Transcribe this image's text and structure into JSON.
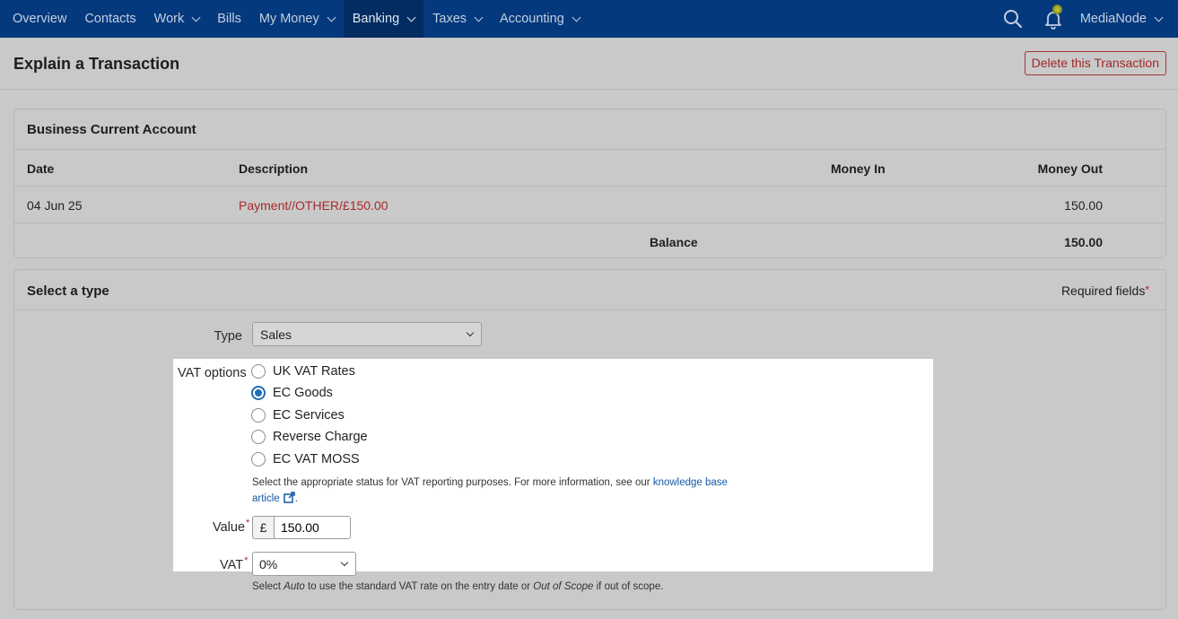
{
  "nav": {
    "items": [
      {
        "label": "Overview",
        "has_menu": false
      },
      {
        "label": "Contacts",
        "has_menu": false
      },
      {
        "label": "Work",
        "has_menu": true
      },
      {
        "label": "Bills",
        "has_menu": false
      },
      {
        "label": "My Money",
        "has_menu": true
      },
      {
        "label": "Banking",
        "has_menu": true,
        "active": true
      },
      {
        "label": "Taxes",
        "has_menu": true
      },
      {
        "label": "Accounting",
        "has_menu": true
      }
    ],
    "user": "MediaNode",
    "icons": [
      "search-icon",
      "bell-icon"
    ],
    "bar_color": "#04397d"
  },
  "page": {
    "title": "Explain a Transaction",
    "delete_label": "Delete this Transaction"
  },
  "account": {
    "title": "Business Current Account",
    "columns": {
      "date": "Date",
      "description": "Description",
      "money_in": "Money In",
      "money_out": "Money Out"
    },
    "row": {
      "date": "04 Jun 25",
      "description": "Payment//OTHER/£150.00",
      "money_in": "",
      "money_out": "150.00"
    },
    "balance_label": "Balance",
    "balance_value": "150.00"
  },
  "type_section": {
    "title": "Select a type",
    "required_label": "Required fields",
    "type_label": "Type",
    "type_value": "Sales",
    "vat_options_label": "VAT options",
    "vat_options": [
      {
        "label": "UK VAT Rates",
        "checked": false
      },
      {
        "label": "EC Goods",
        "checked": true
      },
      {
        "label": "EC Services",
        "checked": false
      },
      {
        "label": "Reverse Charge",
        "checked": false
      },
      {
        "label": "EC VAT MOSS",
        "checked": false
      }
    ],
    "help_text": "Select the appropriate status for VAT reporting purposes. For more information, see our",
    "help_link_1": "knowledge base",
    "help_link_2": "article",
    "help_end": ".",
    "value_label": "Value",
    "currency_symbol": "£",
    "value": "150.00",
    "vat_label": "VAT",
    "vat_value": "0%",
    "vat_note_1": "Select",
    "vat_note_auto": "Auto",
    "vat_note_2": "to use the standard VAT rate on the entry date or",
    "vat_note_oos": "Out of Scope",
    "vat_note_3": "if out of scope."
  }
}
